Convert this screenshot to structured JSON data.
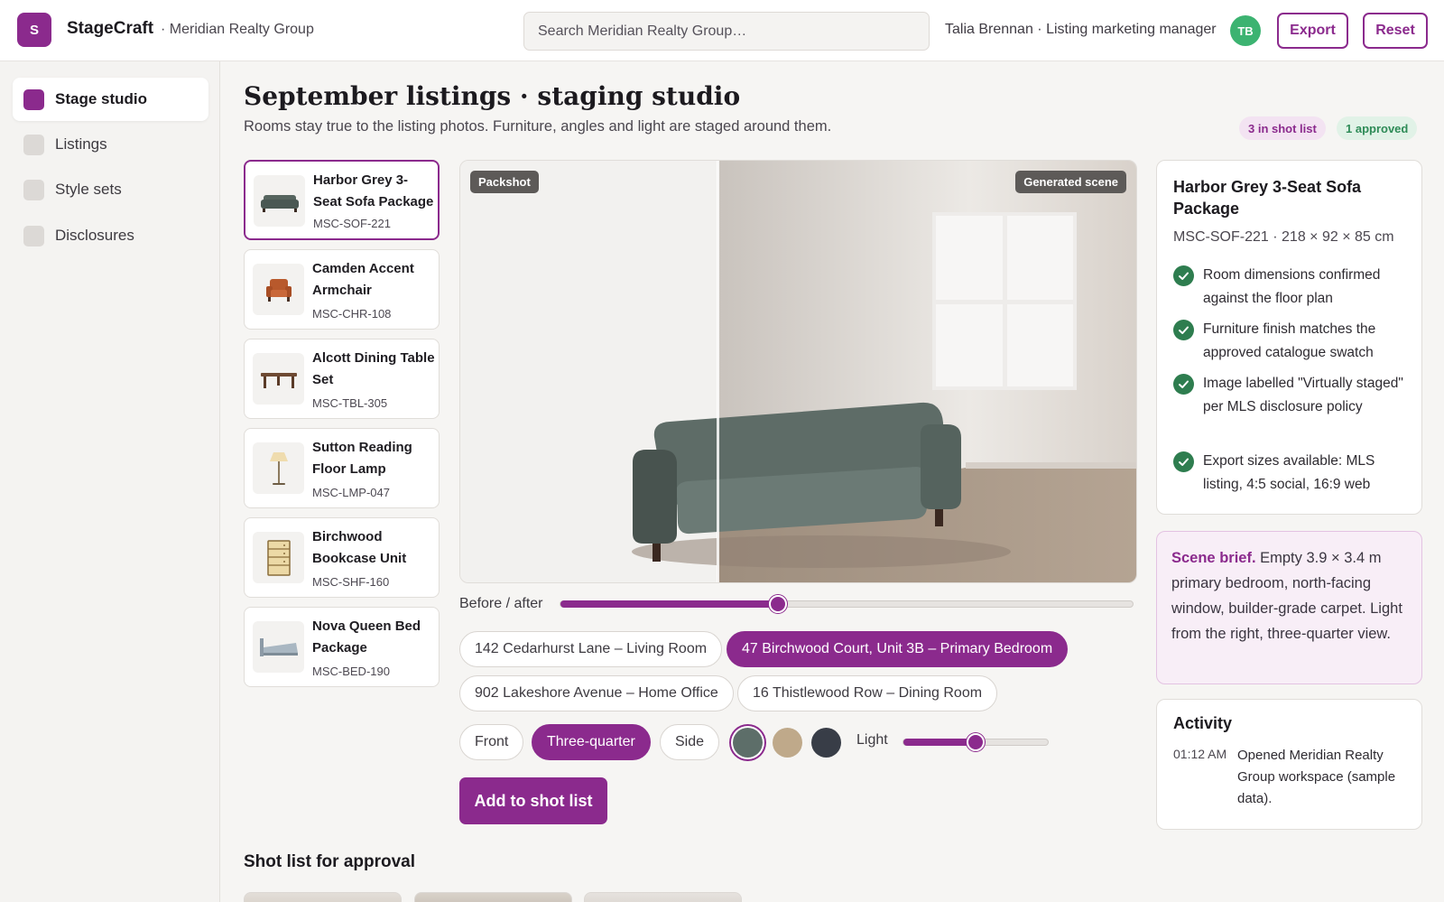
{
  "app": {
    "logo_letter": "S",
    "name": "StageCraft",
    "org": "· Meridian Realty Group",
    "search_placeholder": "Search Meridian Realty Group…",
    "user": "Talia Brennan · Listing marketing manager",
    "avatar_initials": "TB",
    "export_label": "Export",
    "reset_label": "Reset",
    "accent": "#8b2a8d"
  },
  "sidebar": {
    "items": [
      {
        "label": "Stage studio",
        "active": true
      },
      {
        "label": "Listings",
        "active": false
      },
      {
        "label": "Style sets",
        "active": false
      },
      {
        "label": "Disclosures",
        "active": false
      }
    ]
  },
  "main": {
    "title": "September listings · staging studio",
    "subtitle": "Rooms stay true to the listing photos. Furniture, angles and light are staged around them.",
    "badge_shot": "3 in shot list",
    "badge_approved": "1 approved"
  },
  "products": [
    {
      "name": "Harbor Grey 3-Seat Sofa Package",
      "sku": "MSC-SOF-221",
      "icon": "sofa-icon",
      "selected": true
    },
    {
      "name": "Camden Accent Armchair",
      "sku": "MSC-CHR-108",
      "icon": "armchair-icon",
      "selected": false
    },
    {
      "name": "Alcott Dining Table Set",
      "sku": "MSC-TBL-305",
      "icon": "table-icon",
      "selected": false
    },
    {
      "name": "Sutton Reading Floor Lamp",
      "sku": "MSC-LMP-047",
      "icon": "lamp-icon",
      "selected": false
    },
    {
      "name": "Birchwood Bookcase Unit",
      "sku": "MSC-SHF-160",
      "icon": "bookcase-icon",
      "selected": false
    },
    {
      "name": "Nova Queen Bed Package",
      "sku": "MSC-BED-190",
      "icon": "bed-icon",
      "selected": false
    }
  ],
  "viewer": {
    "tag_left": "Packshot",
    "tag_right": "Generated scene",
    "before_after_label": "Before / after",
    "before_after_value": 0.38
  },
  "rooms": [
    {
      "label": "142 Cedarhurst Lane – Living Room",
      "active": false
    },
    {
      "label": "47 Birchwood Court, Unit 3B – Primary Bedroom",
      "active": true
    },
    {
      "label": "902 Lakeshore Avenue – Home Office",
      "active": false
    },
    {
      "label": "16 Thistlewood Row – Dining Room",
      "active": false
    }
  ],
  "angles": [
    {
      "label": "Front",
      "active": false
    },
    {
      "label": "Three-quarter",
      "active": true
    },
    {
      "label": "Side",
      "active": false
    }
  ],
  "swatches": [
    {
      "name": "slate-grey",
      "color": "#5d6e69",
      "selected": true
    },
    {
      "name": "sand",
      "color": "#bfa98a",
      "selected": false
    },
    {
      "name": "charcoal",
      "color": "#383d47",
      "selected": false
    }
  ],
  "light": {
    "label": "Light",
    "value": 0.5
  },
  "add_button": "Add to shot list",
  "shot_list": {
    "title": "Shot list for approval"
  },
  "detail": {
    "title": "Harbor Grey 3-Seat Sofa Package",
    "meta": "MSC-SOF-221 · 218 × 92 × 85 cm",
    "checks": [
      "Room dimensions confirmed against the floor plan",
      "Furniture finish matches the approved catalogue swatch",
      "Image labelled \"Virtually staged\" per MLS disclosure policy",
      "Export sizes available: MLS listing, 4:5 social, 16:9 web"
    ]
  },
  "brief": {
    "strong": "Scene brief.",
    "text": " Empty 3.9 × 3.4 m primary bedroom, north-facing window, builder-grade carpet. Light from the right, three-quarter view."
  },
  "activity": {
    "title": "Activity",
    "items": [
      {
        "time": "01:12 AM",
        "text": "Opened Meridian Realty Group workspace (sample data)."
      }
    ]
  }
}
